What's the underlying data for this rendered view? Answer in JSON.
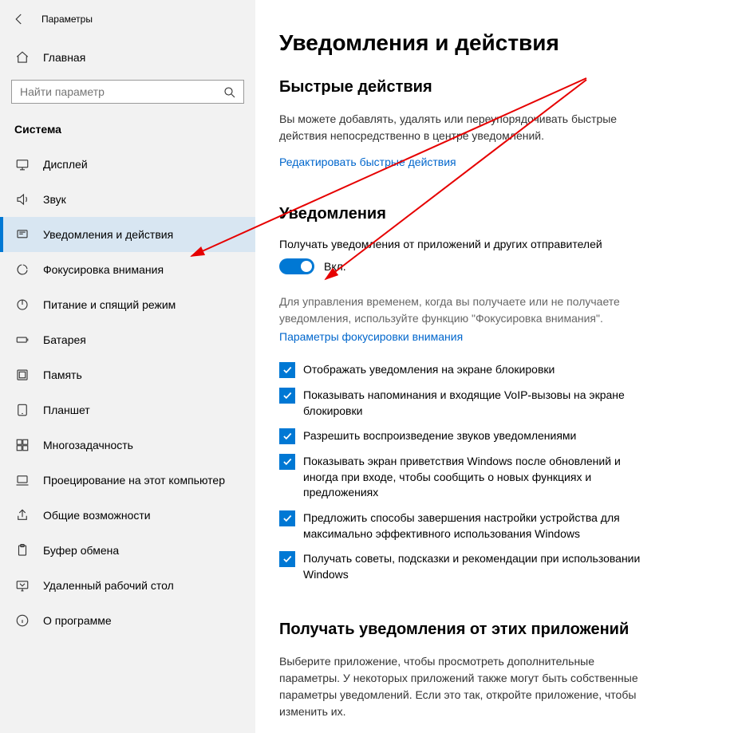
{
  "titlebar": {
    "title": "Параметры"
  },
  "home": {
    "label": "Главная"
  },
  "search": {
    "placeholder": "Найти параметр"
  },
  "group_header": "Система",
  "nav": [
    {
      "label": "Дисплей",
      "icon": "display-icon",
      "active": false
    },
    {
      "label": "Звук",
      "icon": "sound-icon",
      "active": false
    },
    {
      "label": "Уведомления и действия",
      "icon": "notifications-icon",
      "active": true
    },
    {
      "label": "Фокусировка внимания",
      "icon": "focus-icon",
      "active": false
    },
    {
      "label": "Питание и спящий режим",
      "icon": "power-icon",
      "active": false
    },
    {
      "label": "Батарея",
      "icon": "battery-icon",
      "active": false
    },
    {
      "label": "Память",
      "icon": "storage-icon",
      "active": false
    },
    {
      "label": "Планшет",
      "icon": "tablet-icon",
      "active": false
    },
    {
      "label": "Многозадачность",
      "icon": "multitask-icon",
      "active": false
    },
    {
      "label": "Проецирование на этот компьютер",
      "icon": "projecting-icon",
      "active": false
    },
    {
      "label": "Общие возможности",
      "icon": "shared-icon",
      "active": false
    },
    {
      "label": "Буфер обмена",
      "icon": "clipboard-icon",
      "active": false
    },
    {
      "label": "Удаленный рабочий стол",
      "icon": "remote-icon",
      "active": false
    },
    {
      "label": "О программе",
      "icon": "about-icon",
      "active": false
    }
  ],
  "main": {
    "title": "Уведомления и действия",
    "quick": {
      "heading": "Быстрые действия",
      "desc": "Вы можете добавлять, удалять или переупорядочивать быстрые действия непосредственно в центре уведомлений.",
      "link": "Редактировать быстрые действия"
    },
    "notif": {
      "heading": "Уведомления",
      "toggle_label": "Получать уведомления от приложений и других отправителей",
      "toggle_state": "Вкл.",
      "focus_desc": "Для управления временем, когда вы получаете или не получаете уведомления, используйте функцию \"Фокусировка внимания\".",
      "focus_link": "Параметры фокусировки внимания",
      "checks": [
        "Отображать уведомления на экране блокировки",
        "Показывать напоминания и входящие VoIP-вызовы на экране блокировки",
        "Разрешить  воспроизведение звуков уведомлениями",
        "Показывать экран приветствия Windows после обновлений и иногда при входе, чтобы сообщить о новых функциях и предложениях",
        "Предложить способы завершения настройки устройства для максимально эффективного использования Windows",
        "Получать советы, подсказки и рекомендации при использовании Windows"
      ]
    },
    "apps": {
      "heading": "Получать уведомления от этих приложений",
      "desc": "Выберите приложение, чтобы просмотреть дополнительные параметры. У некоторых приложений также могут быть собственные параметры уведомлений. Если это так, откройте приложение, чтобы изменить их."
    }
  }
}
